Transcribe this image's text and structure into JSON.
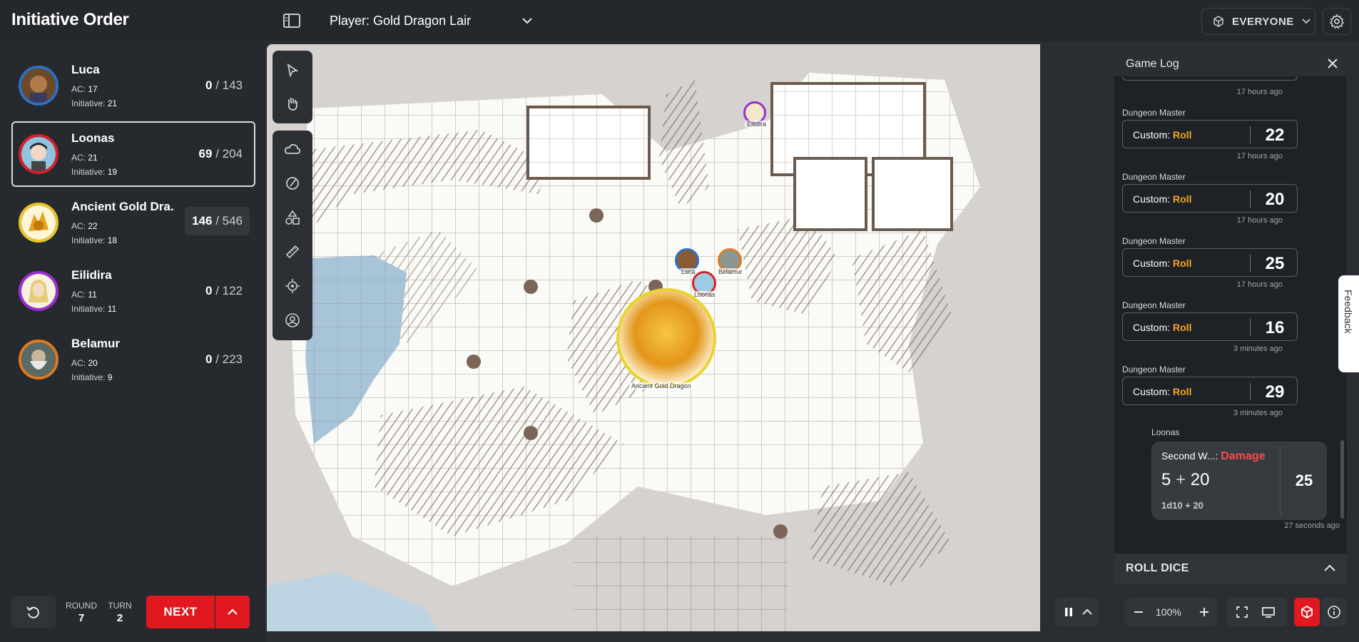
{
  "header": {
    "title": "Initiative Order",
    "player_label": "Player: Gold Dragon Lair",
    "audience_label": "EVERYONE"
  },
  "initiative": {
    "combatants": [
      {
        "name": "Luca",
        "ac_label": "AC:",
        "ac": "17",
        "init_label": "Initiative:",
        "init": "21",
        "hp_current": "0",
        "hp_max": "/ 143",
        "ring": "#2e6fc2",
        "active": false
      },
      {
        "name": "Loonas",
        "ac_label": "AC:",
        "ac": "21",
        "init_label": "Initiative:",
        "init": "19",
        "hp_current": "69",
        "hp_max": "/ 204",
        "ring": "#d8202a",
        "active": true
      },
      {
        "name": "Ancient Gold Dra...",
        "ac_label": "AC:",
        "ac": "22",
        "init_label": "Initiative:",
        "init": "18",
        "hp_current": "146",
        "hp_max": "/ 546",
        "ring": "#e8c62a",
        "active": false
      },
      {
        "name": "Eilidira",
        "ac_label": "AC:",
        "ac": "11",
        "init_label": "Initiative:",
        "init": "11",
        "hp_current": "0",
        "hp_max": "/ 122",
        "ring": "#9b2fd0",
        "active": false
      },
      {
        "name": "Belamur",
        "ac_label": "AC:",
        "ac": "20",
        "init_label": "Initiative:",
        "init": "9",
        "hp_current": "0",
        "hp_max": "/ 223",
        "ring": "#e07a20",
        "active": false
      }
    ],
    "round_label": "ROUND",
    "round": "7",
    "turn_label": "TURN",
    "turn": "2",
    "next_label": "NEXT"
  },
  "map": {
    "tokens": [
      {
        "label": "Eilidira",
        "ring": "#9b2fd0"
      },
      {
        "label": "Luca",
        "ring": "#2e6fc2"
      },
      {
        "label": "Belamur",
        "ring": "#e07a20"
      },
      {
        "label": "Loonas",
        "ring": "#d8202a"
      },
      {
        "label": "Ancient Gold Dragon",
        "ring": "#e8d42a"
      }
    ]
  },
  "toolbar": {
    "tools": [
      "select-icon",
      "pan-hand-icon",
      "fog-cloud-icon",
      "draw-pen-icon",
      "shapes-icon",
      "ruler-icon",
      "target-icon",
      "user-circle-icon"
    ]
  },
  "game_log": {
    "title": "Game Log",
    "first_time": "17 hours ago",
    "entries": [
      {
        "who": "Dungeon Master",
        "prefix": "Custom:",
        "kind": "Roll",
        "total": "22",
        "time": "17 hours ago"
      },
      {
        "who": "Dungeon Master",
        "prefix": "Custom:",
        "kind": "Roll",
        "total": "20",
        "time": "17 hours ago"
      },
      {
        "who": "Dungeon Master",
        "prefix": "Custom:",
        "kind": "Roll",
        "total": "25",
        "time": "17 hours ago"
      },
      {
        "who": "Dungeon Master",
        "prefix": "Custom:",
        "kind": "Roll",
        "total": "16",
        "time": "3 minutes ago"
      },
      {
        "who": "Dungeon Master",
        "prefix": "Custom:",
        "kind": "Roll",
        "total": "29",
        "time": "3 minutes ago"
      }
    ],
    "damage": {
      "who": "Loonas",
      "name": "Second W...:",
      "kind": "Damage",
      "expr_a": "5",
      "expr_op": "+",
      "expr_b": "20",
      "formula": "1d10 + 20",
      "total": "25",
      "time": "27 seconds ago"
    }
  },
  "roll_dice": {
    "label": "ROLL DICE"
  },
  "feedback": {
    "label": "Feedback"
  },
  "zoom": {
    "value": "100%"
  },
  "colors": {
    "accent": "#e0181f",
    "roll_keyword": "#f5a623",
    "damage_keyword": "#ff4a4a"
  }
}
